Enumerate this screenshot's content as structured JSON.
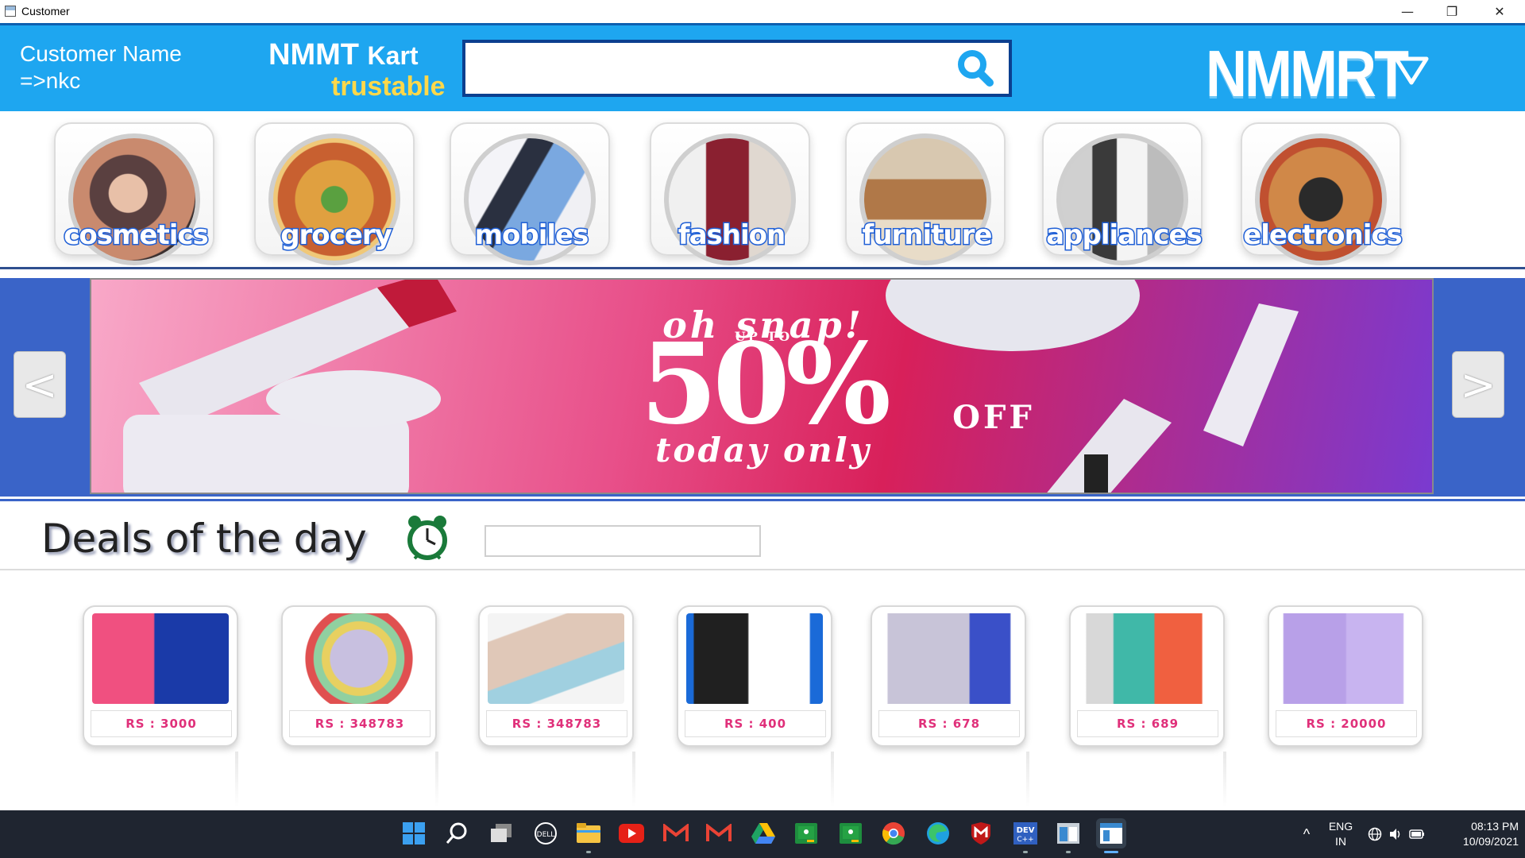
{
  "window": {
    "title": "Customer",
    "minimize": "—",
    "restore": "❐",
    "close": "✕"
  },
  "header": {
    "customer_label": "Customer Name",
    "customer_name": "=>nkc",
    "brand": "NMMT",
    "brand_suffix": "Kart",
    "tagline": "trustable",
    "search_placeholder": "",
    "search_icon": "search-icon",
    "logo": "NMMRT",
    "menu_icon": "dropdown-triangle-icon",
    "colors": {
      "header_bg": "#1ea6f0",
      "tagline": "#ffd84a",
      "search_border": "#0b3f8f"
    }
  },
  "categories": [
    {
      "label": "cosmetics",
      "color": "#c98a6e"
    },
    {
      "label": "grocery",
      "color": "#e0a040"
    },
    {
      "label": "mobiles",
      "color": "#7aa8e0"
    },
    {
      "label": "fashion",
      "color": "#8a2030"
    },
    {
      "label": "furniture",
      "color": "#b07848"
    },
    {
      "label": "appliances",
      "color": "#9a9a9a"
    },
    {
      "label": "electronics",
      "color": "#d08848"
    }
  ],
  "banner": {
    "line1": "oh snap!",
    "line2": "UP TO",
    "line3": "50%",
    "line4": "OFF",
    "line5": "today only",
    "prev_label": "<",
    "next_label": ">"
  },
  "deals": {
    "title": "Deals of the day",
    "alarm_icon": "alarm-clock-icon",
    "timer_value": "",
    "products": [
      {
        "price": "RS : 3000",
        "color": "#1a3aa8"
      },
      {
        "price": "RS : 348783",
        "color": "#c8c0e0"
      },
      {
        "price": "RS : 348783",
        "color": "#e0c8b8"
      },
      {
        "price": "RS : 400",
        "color": "#1a6ad8"
      },
      {
        "price": "RS : 678",
        "color": "#c8c4d8"
      },
      {
        "price": "RS : 689",
        "color": "#40b8a8"
      },
      {
        "price": "RS : 20000",
        "color": "#b8a0e8"
      }
    ]
  },
  "taskbar": {
    "apps": [
      {
        "name": "windows-start-icon",
        "color": "#3ba0f0"
      },
      {
        "name": "search-icon",
        "color": "#ffffff"
      },
      {
        "name": "task-view-icon",
        "color": "#dddddd"
      },
      {
        "name": "dell-icon",
        "color": "#ffffff"
      },
      {
        "name": "file-explorer-icon",
        "color": "#f6c443"
      },
      {
        "name": "youtube-icon",
        "color": "#e62117"
      },
      {
        "name": "gmail-icon",
        "color": "#ea4335"
      },
      {
        "name": "gmail-icon-2",
        "color": "#ea4335"
      },
      {
        "name": "google-drive-icon",
        "color": "#1fa463"
      },
      {
        "name": "google-classroom-icon",
        "color": "#1e8e3e"
      },
      {
        "name": "google-classroom-icon-2",
        "color": "#1e8e3e"
      },
      {
        "name": "chrome-icon",
        "color": "#fbbc05"
      },
      {
        "name": "edge-icon",
        "color": "#1fa1e0"
      },
      {
        "name": "mcafee-icon",
        "color": "#c01818"
      },
      {
        "name": "dev-cpp-icon",
        "color": "#3060c0"
      },
      {
        "name": "app-window-icon",
        "color": "#c8d0d8"
      },
      {
        "name": "java-app-icon",
        "color": "#ffffff"
      }
    ],
    "tray": {
      "chevron": "^",
      "lang": "ENG",
      "region": "IN",
      "time": "08:13 PM",
      "date": "10/09/2021"
    }
  }
}
